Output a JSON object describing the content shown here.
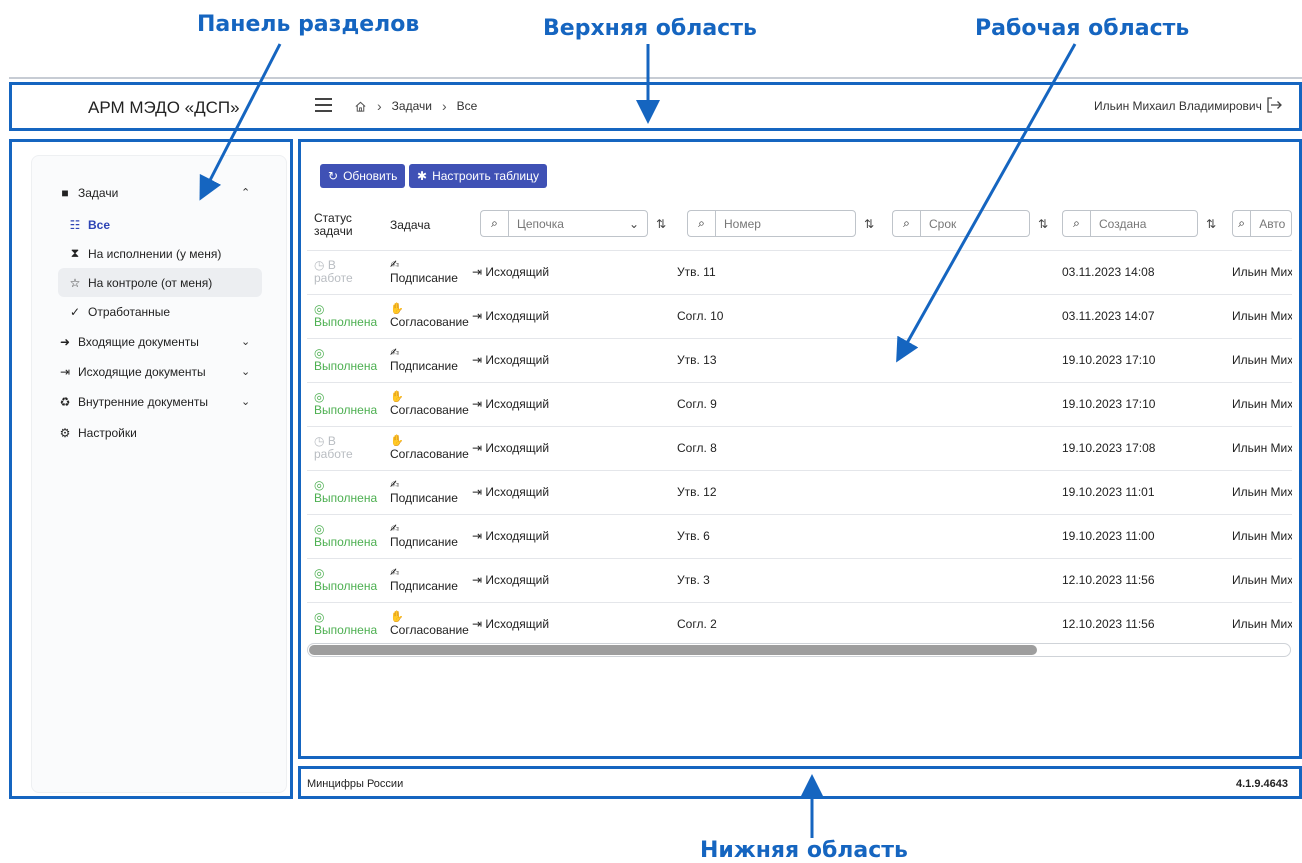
{
  "callouts": {
    "panel": "Панель разделов",
    "top": "Верхняя область",
    "work": "Рабочая область",
    "bottom": "Нижняя область"
  },
  "header": {
    "app_title": "АРМ МЭДО «ДСП»",
    "breadcrumb": [
      "Задачи",
      "Все"
    ],
    "user_name": "Ильин Михаил Владимирович",
    "icons": [
      "menu-icon",
      "home-icon",
      "logout-icon"
    ]
  },
  "sidebar": {
    "items": [
      {
        "label": "Задачи",
        "icon": "briefcase-icon",
        "expanded": true
      },
      {
        "label": "Все",
        "icon": "list-icon",
        "active": true
      },
      {
        "label": "На исполнении (у меня)",
        "icon": "hourglass-icon"
      },
      {
        "label": "На контроле (от меня)",
        "icon": "star-icon"
      },
      {
        "label": "Отработанные",
        "icon": "check-icon"
      },
      {
        "label": "Входящие документы",
        "icon": "sign-in-icon"
      },
      {
        "label": "Исходящие документы",
        "icon": "sign-out-icon"
      },
      {
        "label": "Внутренние документы",
        "icon": "recycle-icon"
      },
      {
        "label": "Настройки",
        "icon": "gears-icon"
      }
    ]
  },
  "toolbar": {
    "refresh_label": "Обновить",
    "configure_label": "Настроить таблицу"
  },
  "table": {
    "col_status": "Статус задачи",
    "col_task": "Задача",
    "filters": {
      "chain": "Цепочка",
      "number": "Номер",
      "deadline": "Срок",
      "created": "Создана",
      "author": "Авто"
    },
    "rows": [
      {
        "status": "В работе",
        "status_type": "work",
        "task": "Подписание",
        "chain": "Исходящий",
        "number": "Утв. 11",
        "created": "03.11.2023 14:08",
        "author": "Ильин Миха"
      },
      {
        "status": "Выполнена",
        "status_type": "done",
        "task": "Согласование",
        "chain": "Исходящий",
        "number": "Согл. 10",
        "created": "03.11.2023 14:07",
        "author": "Ильин Миха"
      },
      {
        "status": "Выполнена",
        "status_type": "done",
        "task": "Подписание",
        "chain": "Исходящий",
        "number": "Утв. 13",
        "created": "19.10.2023 17:10",
        "author": "Ильин Миха"
      },
      {
        "status": "Выполнена",
        "status_type": "done",
        "task": "Согласование",
        "chain": "Исходящий",
        "number": "Согл. 9",
        "created": "19.10.2023 17:10",
        "author": "Ильин Миха"
      },
      {
        "status": "В работе",
        "status_type": "work",
        "task": "Согласование",
        "chain": "Исходящий",
        "number": "Согл. 8",
        "created": "19.10.2023 17:08",
        "author": "Ильин Миха"
      },
      {
        "status": "Выполнена",
        "status_type": "done",
        "task": "Подписание",
        "chain": "Исходящий",
        "number": "Утв. 12",
        "created": "19.10.2023 11:01",
        "author": "Ильин Миха"
      },
      {
        "status": "Выполнена",
        "status_type": "done",
        "task": "Подписание",
        "chain": "Исходящий",
        "number": "Утв. 6",
        "created": "19.10.2023 11:00",
        "author": "Ильин Миха"
      },
      {
        "status": "Выполнена",
        "status_type": "done",
        "task": "Подписание",
        "chain": "Исходящий",
        "number": "Утв. 3",
        "created": "12.10.2023 11:56",
        "author": "Ильин Миха"
      },
      {
        "status": "Выполнена",
        "status_type": "done",
        "task": "Согласование",
        "chain": "Исходящий",
        "number": "Согл. 2",
        "created": "12.10.2023 11:56",
        "author": "Ильин Миха"
      }
    ],
    "horizontal_scroll_fraction": 0.74
  },
  "footer": {
    "org": "Минцифры России",
    "version": "4.1.9.4643"
  },
  "colors": {
    "callout": "#1565c0",
    "button": "#3f51b5",
    "status_done": "#4caf50",
    "status_work": "#b9bdc2",
    "active_nav": "#2e44b5"
  }
}
